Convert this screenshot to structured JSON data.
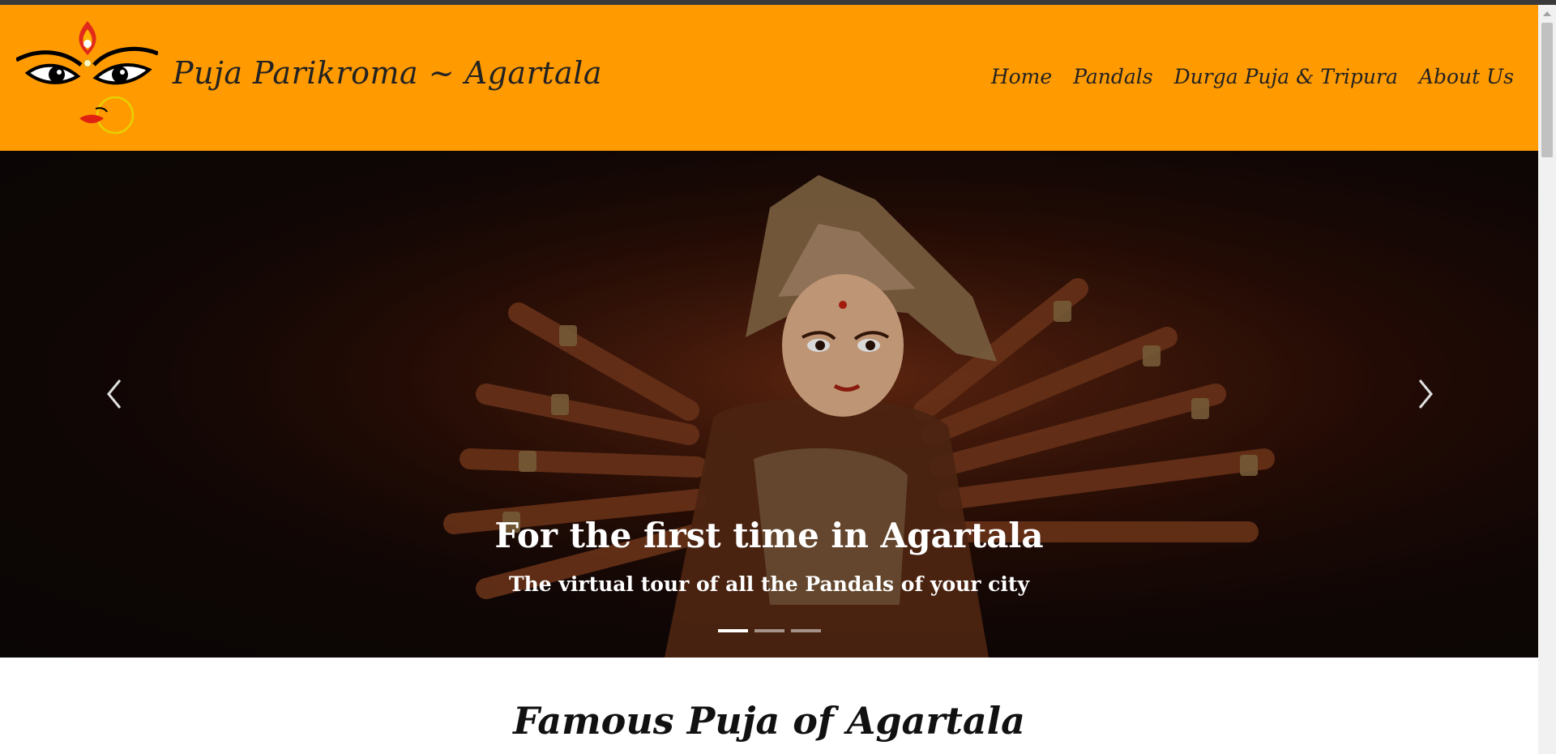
{
  "brand": {
    "title": "Puja Parikroma ~ Agartala",
    "logo_icon": "durga-eyes-logo-icon"
  },
  "nav": {
    "items": [
      {
        "label": "Home"
      },
      {
        "label": "Pandals"
      },
      {
        "label": "Durga Puja & Tripura"
      },
      {
        "label": "About Us"
      }
    ]
  },
  "hero": {
    "title": "For the first time in Agartala",
    "subtitle": "The virtual tour of all the Pandals of your city",
    "slide_count": 3,
    "active_slide": 1,
    "prev_icon": "chevron-left-icon",
    "next_icon": "chevron-right-icon"
  },
  "section": {
    "title": "Famous Puja of Agartala"
  },
  "colors": {
    "navbar_bg": "#ff9a00",
    "hero_bg": "#120806",
    "text_dark": "#222222",
    "text_light": "#ffffff"
  }
}
